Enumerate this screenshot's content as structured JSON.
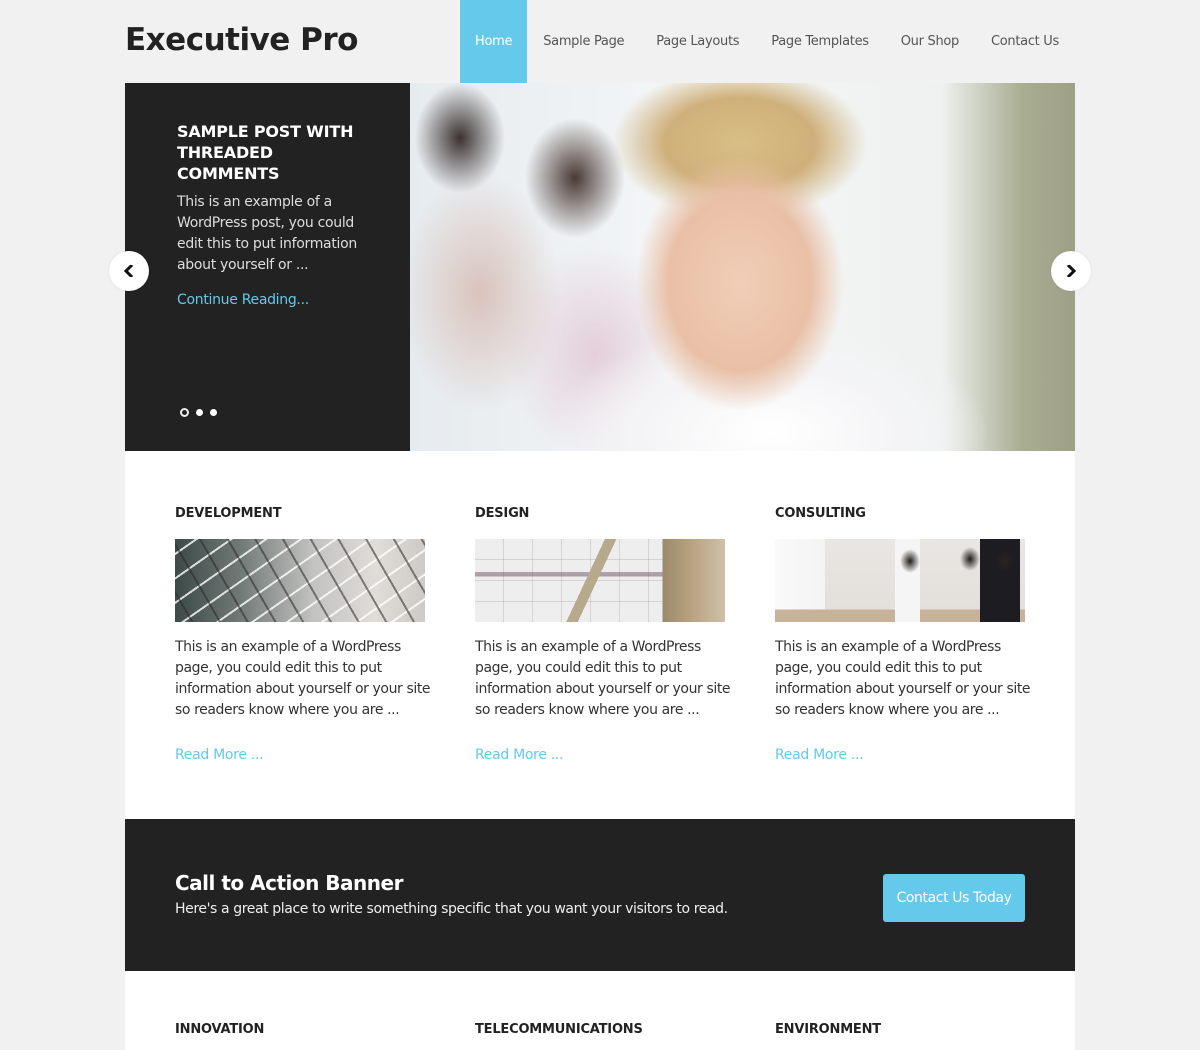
{
  "site": {
    "title": "Executive Pro"
  },
  "nav": {
    "items": [
      {
        "label": "Home",
        "active": true
      },
      {
        "label": "Sample Page"
      },
      {
        "label": "Page Layouts"
      },
      {
        "label": "Page Templates"
      },
      {
        "label": "Our Shop"
      },
      {
        "label": "Contact Us"
      }
    ]
  },
  "hero": {
    "title": "Sample Post With Threaded Comments",
    "excerpt": "This is an example of a WordPress post, you could edit this to put information about yourself or ...",
    "link_label": "Continue Reading...",
    "slide_count": 3,
    "active_slide": 1,
    "prev_icon": "chevron-left-icon",
    "next_icon": "chevron-right-icon"
  },
  "features": [
    {
      "title": "Development",
      "image": "glass-building-photo",
      "text": "This is an example of a WordPress page, you could edit this to put information about yourself or your site so readers know where you are ...",
      "link_label": "Read More ..."
    },
    {
      "title": "Design",
      "image": "blueprint-swatches-photo",
      "text": "This is an example of a WordPress page, you could edit this to put information about yourself or your site so readers know where you are ...",
      "link_label": "Read More ..."
    },
    {
      "title": "Consulting",
      "image": "office-meeting-photo",
      "text": "This is an example of a WordPress page, you could edit this to put information about yourself or your site so readers know where you are ...",
      "link_label": "Read More ..."
    }
  ],
  "cta": {
    "title": "Call to Action Banner",
    "text": "Here's a great place to write something specific that you want your visitors to read.",
    "button_label": "Contact Us Today"
  },
  "bottom_features": [
    {
      "title": "Innovation"
    },
    {
      "title": "Telecommunications"
    },
    {
      "title": "Environment"
    }
  ],
  "colors": {
    "accent": "#64c9ea",
    "dark": "#222222",
    "background": "#f1f1f1"
  }
}
